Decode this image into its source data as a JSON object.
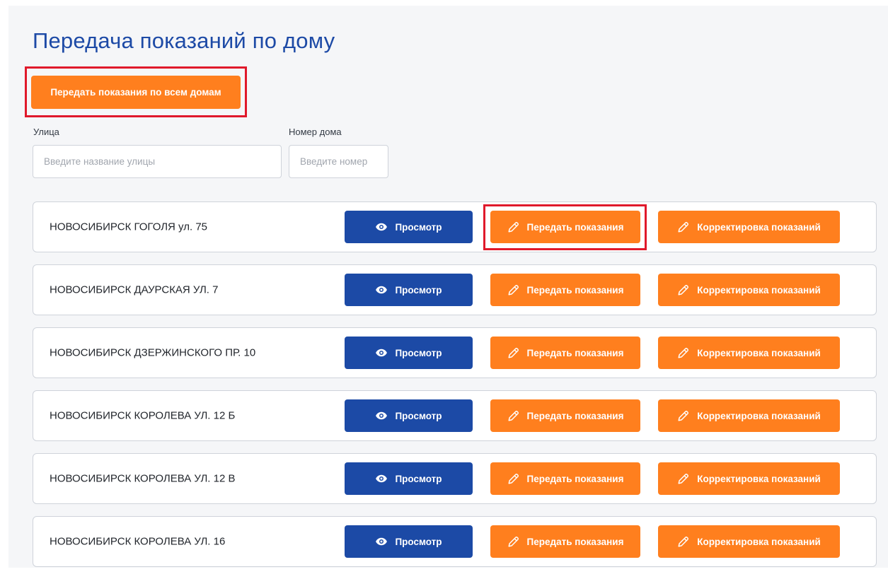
{
  "page": {
    "title": "Передача показаний по дому",
    "send_all_label": "Передать показания по всем домам"
  },
  "filters": {
    "street_label": "Улица",
    "street_placeholder": "Введите название улицы",
    "street_value": "",
    "house_label": "Номер дома",
    "house_placeholder": "Введите номер",
    "house_value": ""
  },
  "actions": {
    "view_label": "Просмотр",
    "view_icon": "eye-icon",
    "send_label": "Передать показания",
    "send_icon": "pencil-icon",
    "correct_label": "Корректировка показаний",
    "correct_icon": "pencil-icon"
  },
  "houses": [
    {
      "address": "НОВОСИБИРСК ГОГОЛЯ ул. 75"
    },
    {
      "address": "НОВОСИБИРСК ДАУРСКАЯ УЛ. 7"
    },
    {
      "address": "НОВОСИБИРСК ДЗЕРЖИНСКОГО ПР. 10"
    },
    {
      "address": "НОВОСИБИРСК КОРОЛЕВА УЛ. 12 Б"
    },
    {
      "address": "НОВОСИБИРСК КОРОЛЕВА УЛ. 12 В"
    },
    {
      "address": "НОВОСИБИРСК КОРОЛЕВА УЛ. 16"
    }
  ],
  "colors": {
    "primary_blue": "#1c4aa6",
    "accent_orange": "#ff7f1e",
    "highlight_red": "#e0192b",
    "title_blue": "#1d4aa6"
  }
}
